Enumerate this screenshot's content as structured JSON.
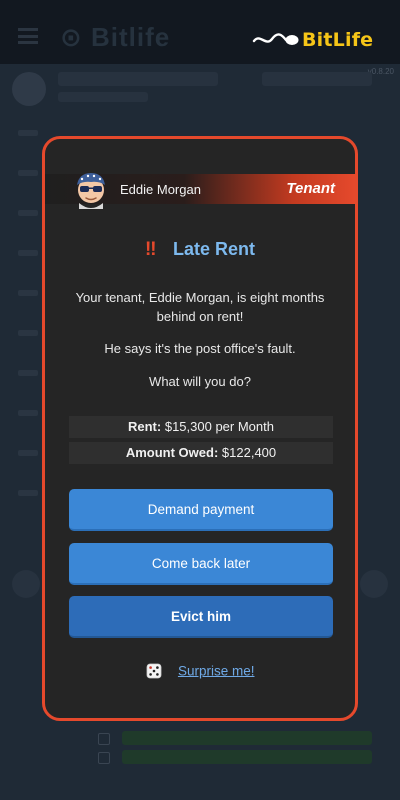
{
  "app": {
    "logo_text": "BitLife",
    "version": "v0.8.20",
    "colors": {
      "accent": "#e5492c",
      "button": "#3b87d6",
      "button_dark": "#2d6cb8",
      "link": "#6fa9e6",
      "title": "#7db9ee",
      "logo": "#f5c518"
    }
  },
  "modal": {
    "person_name": "Eddie Morgan",
    "role": "Tenant",
    "alert_icon": "‼",
    "title": "Late Rent",
    "message_1": "Your tenant, Eddie Morgan, is eight months behind on rent!",
    "message_2": "He says it's the post office's fault.",
    "message_3": "What will you do?",
    "stats": [
      {
        "label": "Rent:",
        "value": "$15,300 per Month"
      },
      {
        "label": "Amount Owed:",
        "value": "$122,400"
      }
    ],
    "buttons": [
      {
        "label": "Demand payment"
      },
      {
        "label": "Come back later"
      },
      {
        "label": "Evict him"
      }
    ],
    "surprise_label": "Surprise me!",
    "icons": {
      "avatar": "avatar-icon",
      "dice": "dice-icon",
      "alert": "double-exclamation-icon"
    }
  }
}
